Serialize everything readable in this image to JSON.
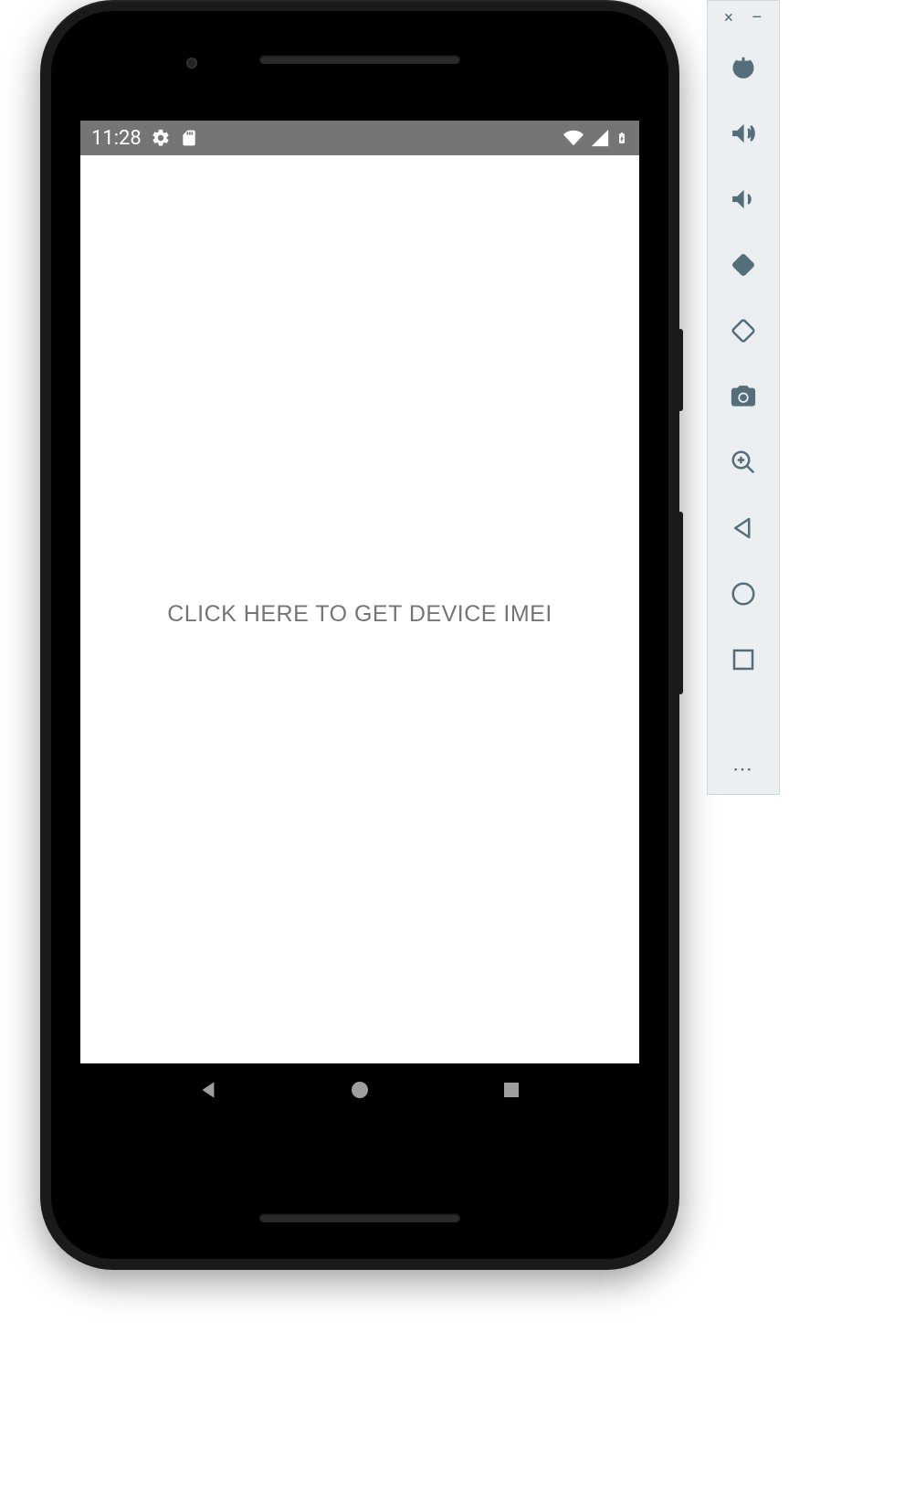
{
  "status_bar": {
    "time": "11:28",
    "icons": {
      "settings": "gear-icon",
      "sdcard": "sd-card-icon",
      "wifi": "wifi-icon",
      "signal": "signal-icon",
      "battery": "battery-charging-icon"
    }
  },
  "app": {
    "imei_button_label": "CLICK HERE TO GET DEVICE IMEI"
  },
  "nav_bar": {
    "back": "back-icon",
    "home": "home-icon",
    "overview": "overview-icon"
  },
  "emulator_toolbar": {
    "window": {
      "close": "×",
      "minimize": "–"
    },
    "buttons": [
      {
        "name": "power-icon",
        "label": "Power"
      },
      {
        "name": "volume-up-icon",
        "label": "Volume Up"
      },
      {
        "name": "volume-down-icon",
        "label": "Volume Down"
      },
      {
        "name": "rotate-left-icon",
        "label": "Rotate Left"
      },
      {
        "name": "rotate-right-icon",
        "label": "Rotate Right"
      },
      {
        "name": "camera-icon",
        "label": "Take Screenshot"
      },
      {
        "name": "zoom-in-icon",
        "label": "Zoom"
      },
      {
        "name": "back-icon",
        "label": "Back"
      },
      {
        "name": "home-icon",
        "label": "Home"
      },
      {
        "name": "overview-icon",
        "label": "Overview"
      }
    ],
    "more": "⋯"
  }
}
